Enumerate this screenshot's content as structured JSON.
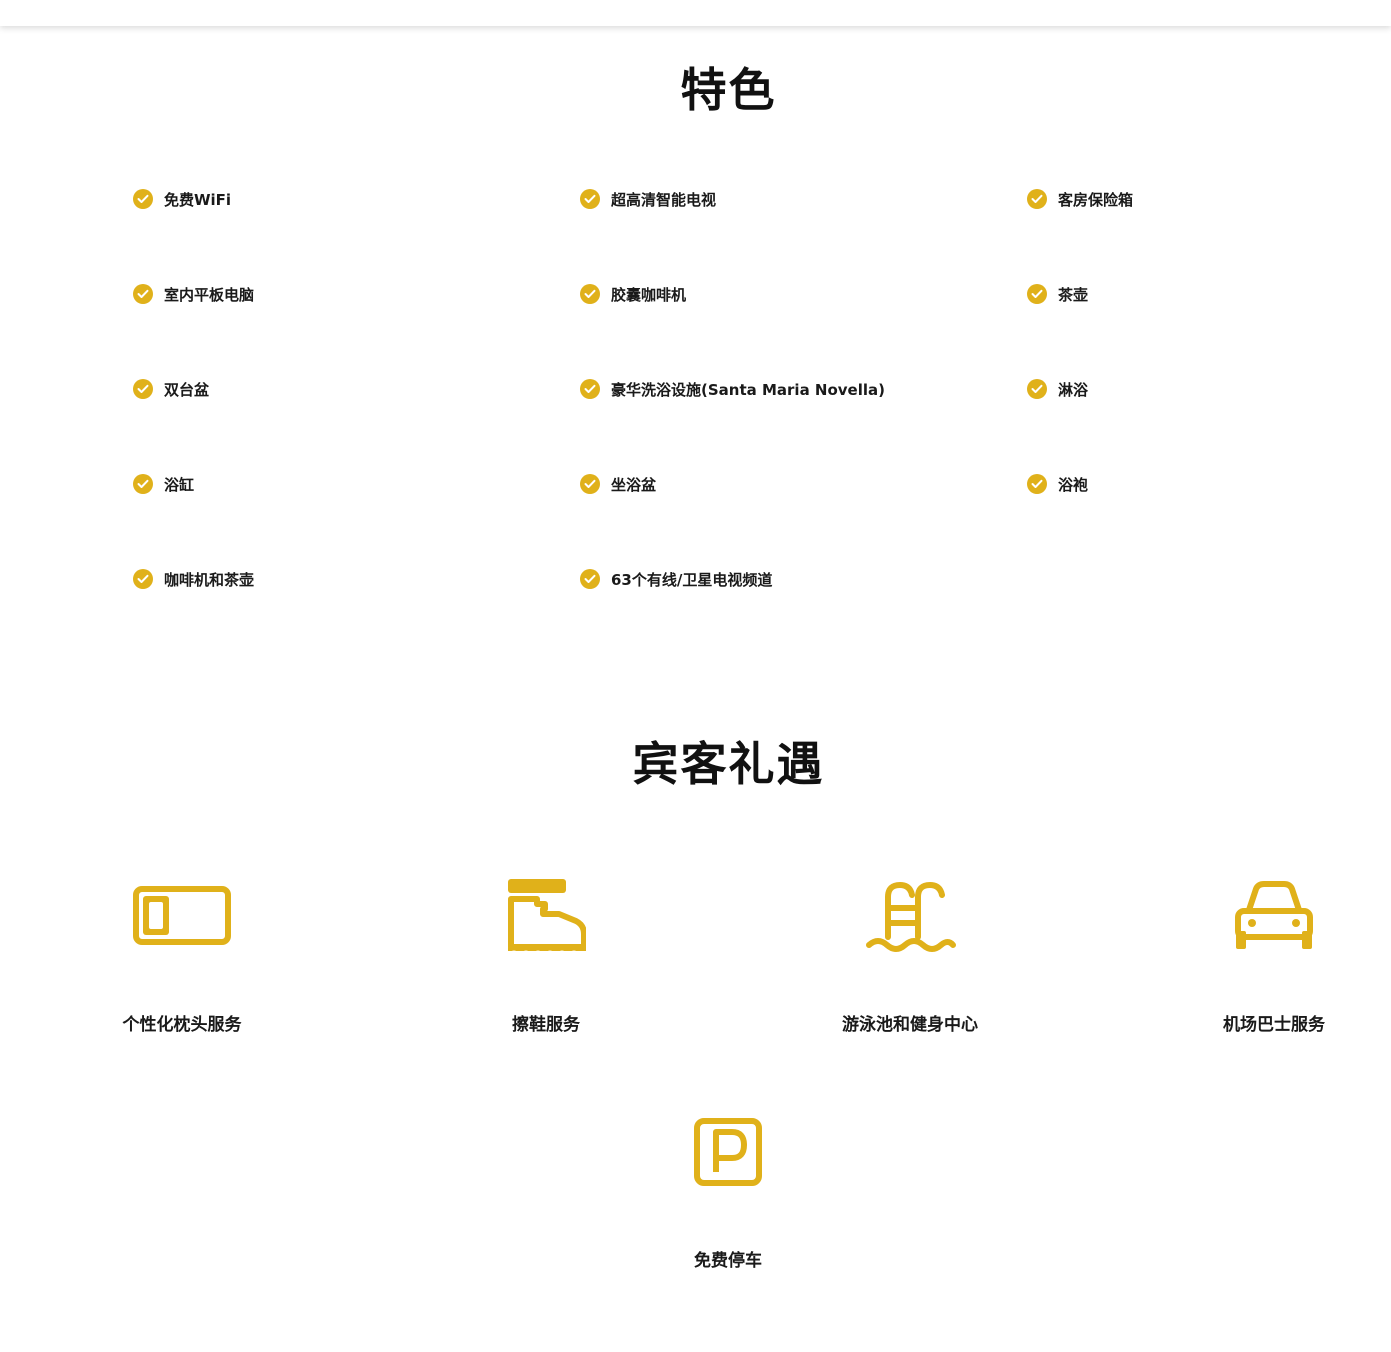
{
  "features": {
    "title": "特色",
    "items": [
      {
        "label": "免费WiFi"
      },
      {
        "label": "超高清智能电视"
      },
      {
        "label": "客房保险箱"
      },
      {
        "label": "室内平板电脑"
      },
      {
        "label": "胶囊咖啡机"
      },
      {
        "label": "茶壶"
      },
      {
        "label": "双台盆"
      },
      {
        "label": "豪华洗浴设施(Santa Maria Novella)"
      },
      {
        "label": "淋浴"
      },
      {
        "label": "浴缸"
      },
      {
        "label": "坐浴盆"
      },
      {
        "label": "浴袍"
      },
      {
        "label": "咖啡机和茶壶"
      },
      {
        "label": "63个有线/卫星电视频道"
      }
    ]
  },
  "perks": {
    "title": "宾客礼遇",
    "items": [
      {
        "label": "个性化枕头服务",
        "icon": "pillow-icon"
      },
      {
        "label": "擦鞋服务",
        "icon": "shoe-icon"
      },
      {
        "label": "游泳池和健身中心",
        "icon": "pool-icon"
      },
      {
        "label": "机场巴士服务",
        "icon": "car-icon"
      },
      {
        "label": "免费停车",
        "icon": "parking-icon"
      }
    ]
  },
  "colors": {
    "accent": "#e0b11a",
    "text": "#1a1a1a"
  }
}
